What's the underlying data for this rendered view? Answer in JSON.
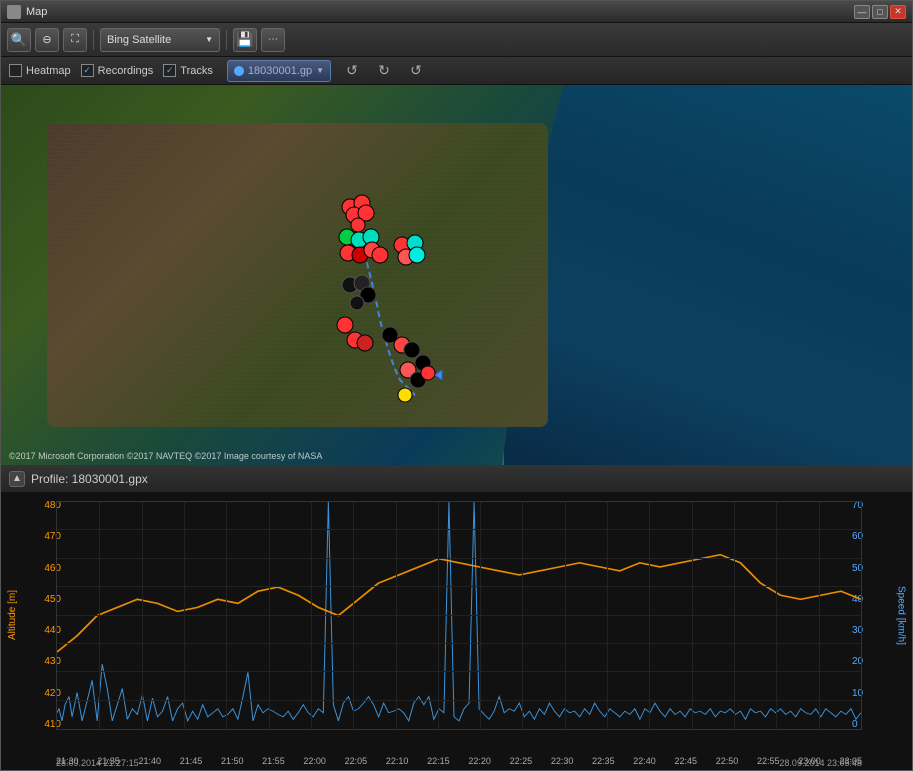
{
  "window": {
    "title": "Map",
    "icon": "map-icon"
  },
  "window_controls": {
    "minimize": "—",
    "maximize": "□",
    "close": "✕"
  },
  "toolbar": {
    "zoom_in": "+",
    "zoom_out": "−",
    "fit": "⊡",
    "map_provider": "Bing Satellite",
    "save_icon": "💾"
  },
  "checkbar": {
    "heatmap_label": "Heatmap",
    "heatmap_checked": false,
    "recordings_label": "Recordings",
    "recordings_checked": true,
    "tracks_label": "Tracks",
    "tracks_checked": true,
    "file_name": "18030001.gp",
    "refresh1": "↺",
    "refresh2": "↺",
    "refresh3": "↺"
  },
  "map": {
    "copyright": "©2017 Microsoft Corporation ©2017 NAVTEQ ©2017 Image courtesy of NASA"
  },
  "profile": {
    "title": "Profile: 18030001.gpx",
    "collapse_icon": "▲"
  },
  "chart": {
    "y_left_label": "Altitude [m]",
    "y_right_label": "Speed [km/h]",
    "y_left_values": [
      "410",
      "420",
      "430",
      "440",
      "450",
      "460",
      "470",
      "480"
    ],
    "y_right_values": [
      "0",
      "10",
      "20",
      "30",
      "40",
      "50",
      "60",
      "70"
    ],
    "x_labels": [
      "21:30",
      "21:35",
      "21:40",
      "21:45",
      "21:50",
      "21:55",
      "22:00",
      "22:05",
      "22:10",
      "22:15",
      "22:20",
      "22:25",
      "22:30",
      "22:35",
      "22:40",
      "22:45",
      "22:50",
      "22:55",
      "23:00",
      "23:05"
    ],
    "bottom_left": "28.09.2014 21:27:15",
    "bottom_right": "28.09.2014 23:05:48",
    "altitude_color": "#f90",
    "speed_color": "#4af"
  }
}
